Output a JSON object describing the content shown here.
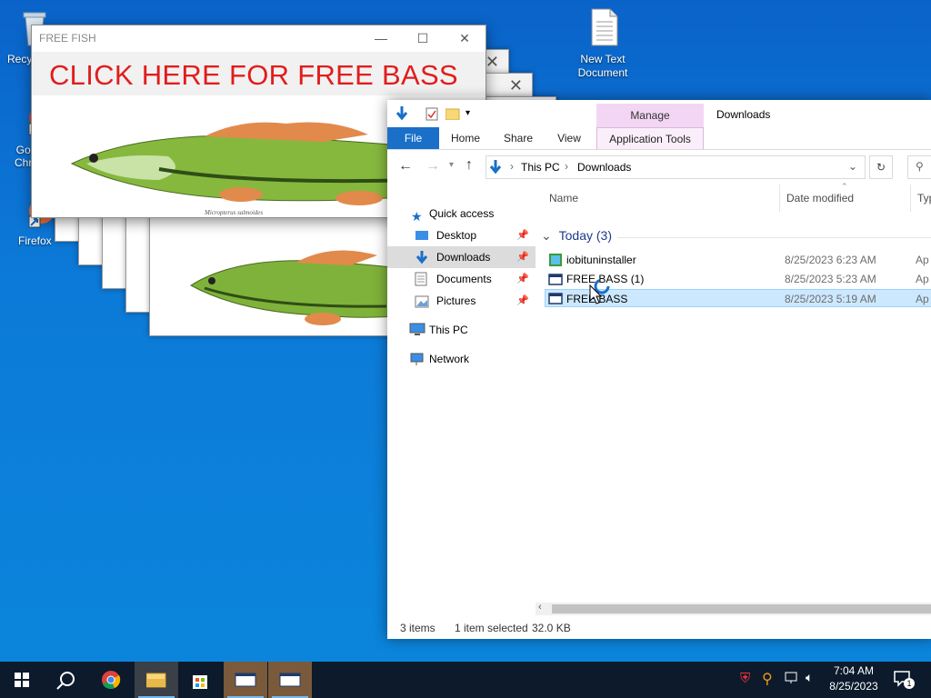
{
  "desktop": {
    "icons": [
      {
        "label": "Recy",
        "icon": "recycle-bin-icon"
      },
      {
        "label": "Go\nChr",
        "icon": "chrome-icon"
      },
      {
        "label": "Firefox",
        "icon": "firefox-icon"
      },
      {
        "label": "New Text\nDocument",
        "icon": "text-document-icon"
      }
    ]
  },
  "popup": {
    "title": "FREE FISH",
    "banner": "CLICK HERE FOR FREE BASS",
    "caption": "Micropterus salmoides"
  },
  "explorer": {
    "title": "Downloads",
    "context_tab": "Manage",
    "tabs": [
      "File",
      "Home",
      "Share",
      "View",
      "Application Tools"
    ],
    "breadcrumb": [
      "This PC",
      "Downloads"
    ],
    "nav": {
      "quick_access": "Quick access",
      "pinned": [
        "Desktop",
        "Downloads",
        "Documents",
        "Pictures"
      ],
      "this_pc": "This PC",
      "network": "Network"
    },
    "columns": [
      "Name",
      "Date modified",
      "Typ"
    ],
    "group": "Today (3)",
    "files": [
      {
        "name": "iobituninstaller",
        "date": "8/25/2023 6:23 AM",
        "type": "Ap",
        "icon": "installer-icon"
      },
      {
        "name": "FREE BASS (1)",
        "date": "8/25/2023 5:23 AM",
        "type": "Ap",
        "icon": "application-window-icon"
      },
      {
        "name": "FREE BASS",
        "date": "8/25/2023 5:19 AM",
        "type": "Ap",
        "icon": "application-window-icon",
        "selected": true
      }
    ],
    "status": {
      "items": "3 items",
      "selected": "1 item selected",
      "size": "32.0 KB"
    }
  },
  "taskbar": {
    "time": "7:04 AM",
    "date": "8/25/2023",
    "notifications": "1"
  },
  "colors": {
    "file_tab": "#1a6fc9",
    "banner_text": "#e11d1d",
    "selection": "#cce8ff",
    "taskbar": "#0c1a2c"
  }
}
